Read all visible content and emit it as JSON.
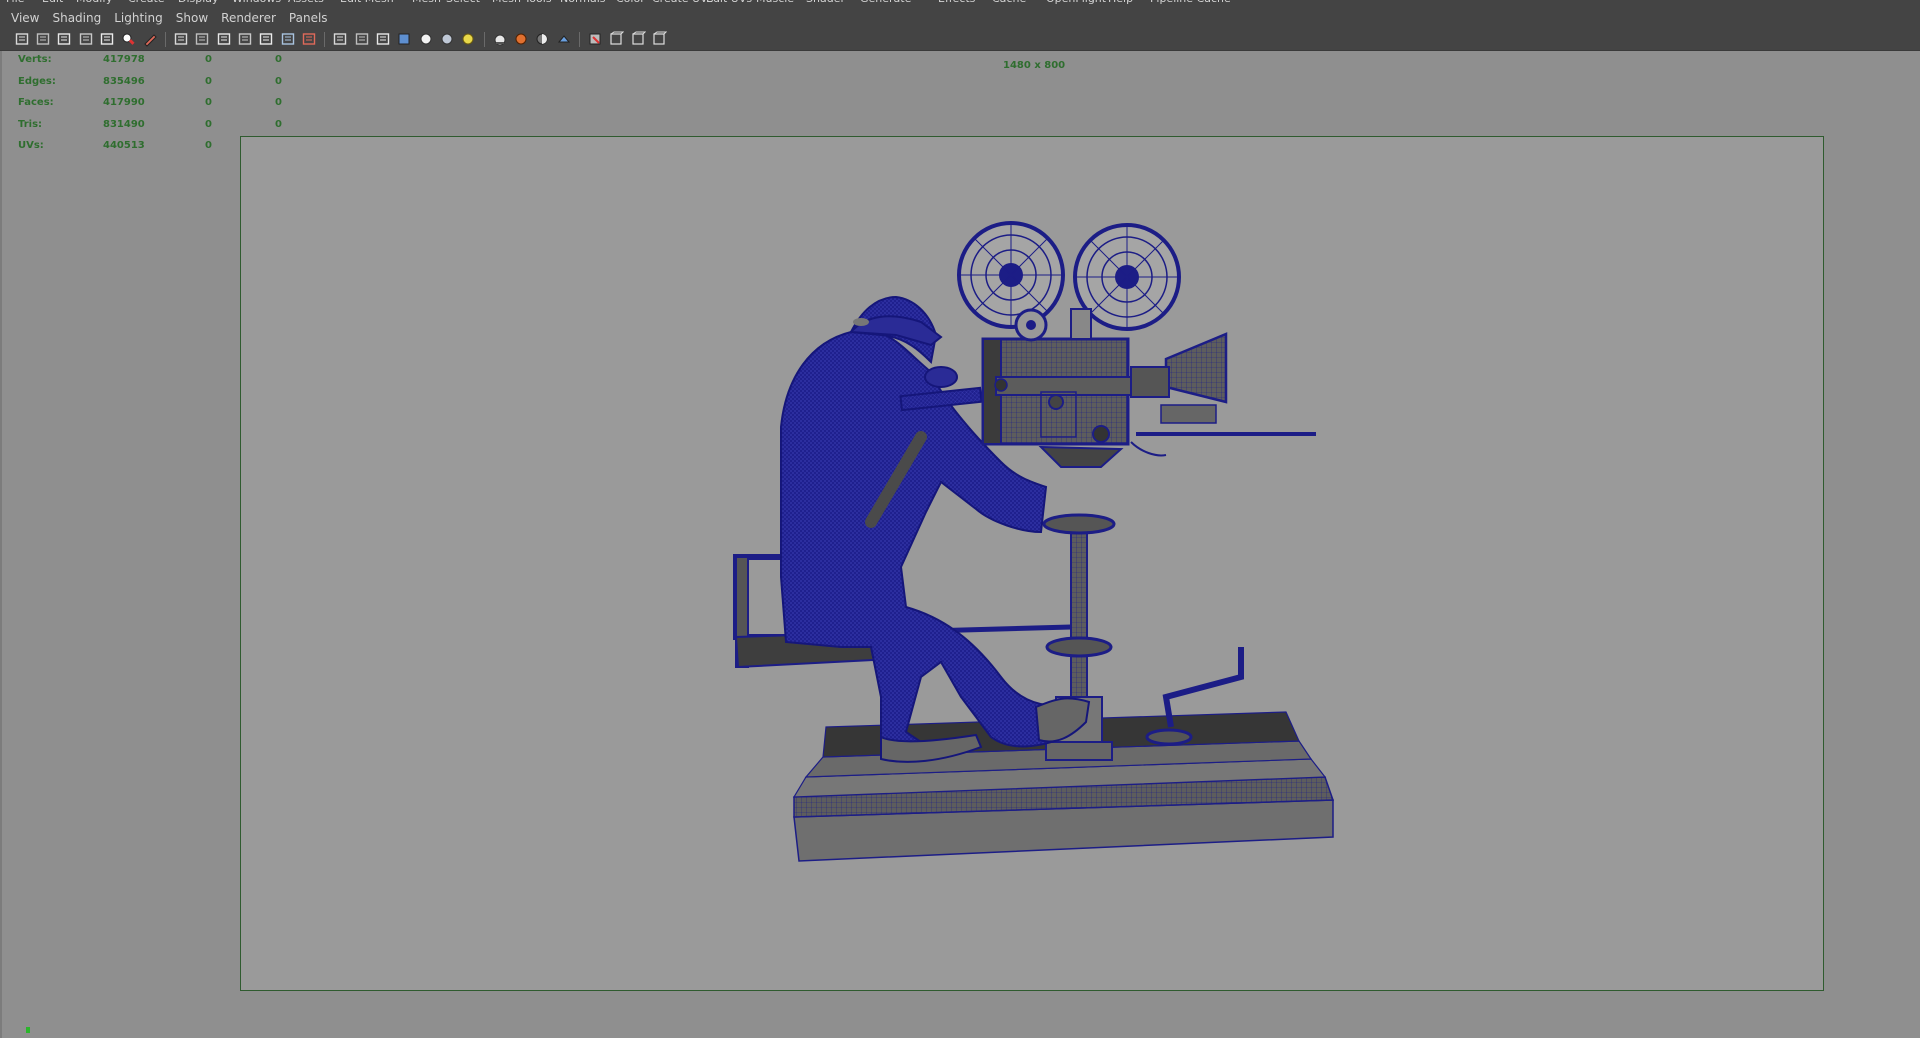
{
  "menus": {
    "main_partial": [
      "File",
      "Edit",
      "Modify",
      "Create",
      "Display",
      "Windows",
      "Assets",
      "Edit Mesh",
      "Mesh",
      "Select",
      "Mesh Tools",
      "Normals",
      "Color",
      "Create UVs",
      "Edit UVs",
      "Muscle",
      "Shader",
      "Generate",
      "Effects",
      "Cache",
      "OpenFlight",
      "Help",
      "Pipeline Cache"
    ],
    "panel": [
      "View",
      "Shading",
      "Lighting",
      "Show",
      "Renderer",
      "Panels"
    ]
  },
  "toolbar": {
    "icons": [
      "select-camera-icon",
      "lock-camera-icon",
      "camera-attributes-icon",
      "bookmark-icon",
      "image-plane-icon",
      "two-d-pan-zoom-icon",
      "grease-pencil-icon",
      "grid-icon",
      "film-gate-icon",
      "resolution-gate-icon",
      "gate-mask-icon",
      "field-chart-icon",
      "safe-action-icon",
      "safe-title-icon",
      "wireframe-icon",
      "smooth-shade-icon",
      "wireframe-on-shaded-icon",
      "textured-icon",
      "shadows-icon",
      "use-all-lights-icon",
      "default-lighting-icon",
      "xray-icon",
      "xray-joints-icon",
      "backface-culling-icon",
      "isolate-select-icon",
      "screen-space-ambient-occlusion-icon",
      "motion-blur-icon",
      "multisample-aa-icon",
      "depth-of-field-icon"
    ]
  },
  "hud": {
    "rows": [
      {
        "label": "Verts:",
        "total": "417978",
        "selected": "0",
        "components": "0"
      },
      {
        "label": "Edges:",
        "total": "835496",
        "selected": "0",
        "components": "0"
      },
      {
        "label": "Faces:",
        "total": "417990",
        "selected": "0",
        "components": "0"
      },
      {
        "label": "Tris:",
        "total": "831490",
        "selected": "0",
        "components": "0"
      },
      {
        "label": "UVs:",
        "total": "440513",
        "selected": "0",
        "components": "0"
      }
    ]
  },
  "viewport": {
    "resolution_label": "1480 x 800",
    "colors": {
      "background": "#8f8f8f",
      "gate_fill": "#9a9a9a",
      "gate_border": "#2f5b2f",
      "hud_text": "#2f6e2f",
      "wireframe": "#1c1d86",
      "model_shade": "#5d5d5d"
    }
  }
}
